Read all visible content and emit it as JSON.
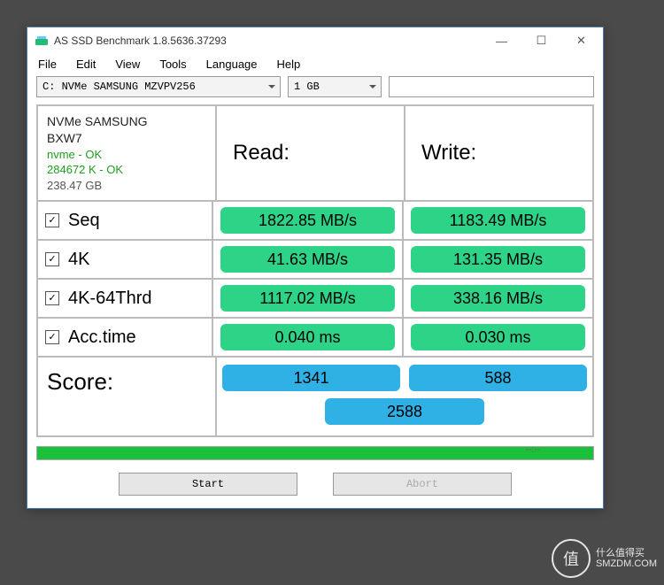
{
  "window": {
    "title": "AS SSD Benchmark 1.8.5636.37293"
  },
  "menu": {
    "file": "File",
    "edit": "Edit",
    "view": "View",
    "tools": "Tools",
    "language": "Language",
    "help": "Help"
  },
  "toolbar": {
    "drive": "C: NVMe SAMSUNG MZVPV256",
    "size": "1 GB"
  },
  "info": {
    "name1": "NVMe SAMSUNG",
    "name2": "BXW7",
    "driver": "nvme - OK",
    "align": "284672 K - OK",
    "capacity": "238.47 GB"
  },
  "headers": {
    "read": "Read:",
    "write": "Write:"
  },
  "tests": {
    "seq": {
      "label": "Seq",
      "read": "1822.85 MB/s",
      "write": "1183.49 MB/s"
    },
    "k4": {
      "label": "4K",
      "read": "41.63 MB/s",
      "write": "131.35 MB/s"
    },
    "k464": {
      "label": "4K-64Thrd",
      "read": "1117.02 MB/s",
      "write": "338.16 MB/s"
    },
    "acc": {
      "label": "Acc.time",
      "read": "0.040 ms",
      "write": "0.030 ms"
    }
  },
  "score": {
    "label": "Score:",
    "read": "1341",
    "write": "588",
    "total": "2588"
  },
  "buttons": {
    "start": "Start",
    "abort": "Abort"
  },
  "watermark": {
    "brand": "什么值得买",
    "site": "SMZDM.COM",
    "char": "值"
  }
}
